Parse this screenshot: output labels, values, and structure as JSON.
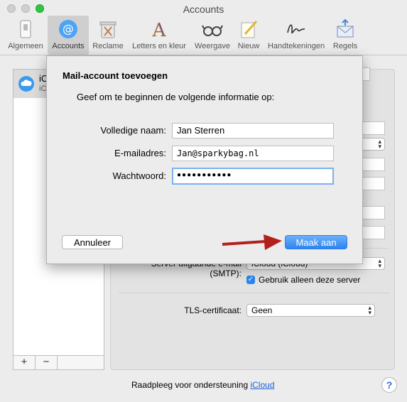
{
  "window": {
    "title": "Accounts"
  },
  "toolbar": {
    "items": [
      {
        "label": "Algemeen",
        "icon": "switch-icon"
      },
      {
        "label": "Accounts",
        "icon": "at-sign-icon"
      },
      {
        "label": "Reclame",
        "icon": "trash-icon"
      },
      {
        "label": "Letters en kleur",
        "icon": "font-color-icon"
      },
      {
        "label": "Weergave",
        "icon": "glasses-icon"
      },
      {
        "label": "Nieuw",
        "icon": "pencil-paper-icon"
      },
      {
        "label": "Handtekeningen",
        "icon": "signature-icon"
      },
      {
        "label": "Regels",
        "icon": "mail-rules-icon"
      }
    ]
  },
  "accounts_list": {
    "row_initial": "iC",
    "row_sub": "iC"
  },
  "list_footer": {
    "add": "+",
    "remove": "−"
  },
  "details": {
    "smtp_label": "Server uitgaande e-mail (SMTP):",
    "smtp_value": "iCloud (iCloud)",
    "only_server_label": "Gebruik alleen deze server",
    "tls_label": "TLS-certificaat:",
    "tls_value": "Geen"
  },
  "support": {
    "text": "Raadpleeg voor ondersteuning",
    "link": "iCloud"
  },
  "help": "?",
  "sheet": {
    "title": "Mail-account toevoegen",
    "subtitle": "Geef om te beginnen de volgende informatie op:",
    "fields": {
      "name_label": "Volledige naam:",
      "name_value": "Jan Sterren",
      "email_label": "E-mailadres:",
      "email_value": "Jan@sparkybag.nl",
      "password_label": "Wachtwoord:",
      "password_value": "●●●●●●●●●●●"
    },
    "cancel_label": "Annuleer",
    "create_label": "Maak aan"
  },
  "colors": {
    "accent": "#2d83f2",
    "arrow": "#b3201c",
    "checkbox": "#2d87f0"
  }
}
